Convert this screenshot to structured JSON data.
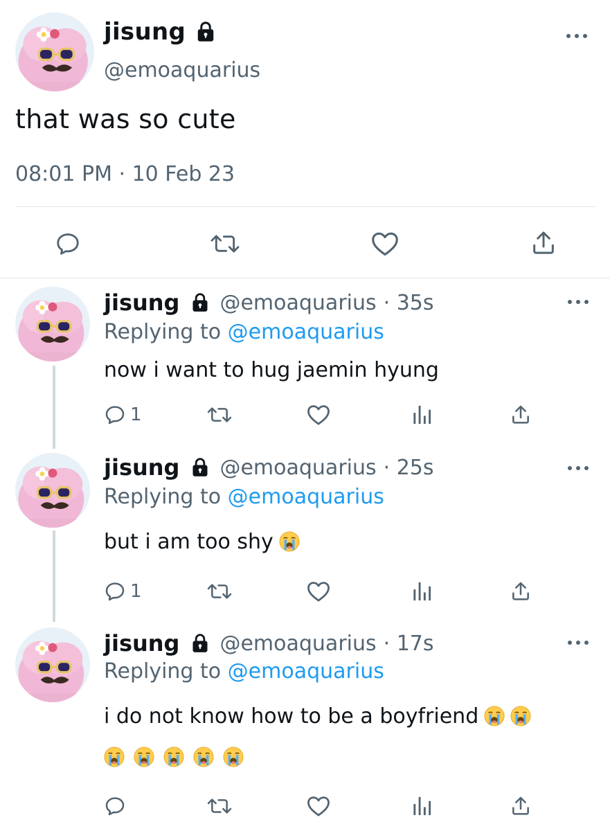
{
  "main_tweet": {
    "author_name": "jisung",
    "handle": "@emoaquarius",
    "text": "that was so cute",
    "timestamp": "08:01 PM · 10 Feb 23",
    "icons": [
      "lock-icon",
      "more-icon",
      "reply-icon",
      "retweet-icon",
      "like-icon",
      "share-icon"
    ]
  },
  "replies": [
    {
      "author_name": "jisung",
      "handle": "@emoaquarius",
      "time": "· 35s",
      "replying_prefix": "Replying to ",
      "replying_to": "@emoaquarius",
      "text": "now i want to hug jaemin hyung",
      "reply_count": "1"
    },
    {
      "author_name": "jisung",
      "handle": "@emoaquarius",
      "time": "· 25s",
      "replying_prefix": "Replying to ",
      "replying_to": "@emoaquarius",
      "text": "but i am too shy",
      "reply_count": "1"
    },
    {
      "author_name": "jisung",
      "handle": "@emoaquarius",
      "time": "· 17s",
      "replying_prefix": "Replying to ",
      "replying_to": "@emoaquarius",
      "text": "i do not know how to be a boyfriend",
      "reply_count": ""
    }
  ],
  "colors": {
    "text": "#0f1419",
    "secondary": "#536471",
    "link": "#1d9bf0",
    "divider": "#e1e6ea"
  }
}
